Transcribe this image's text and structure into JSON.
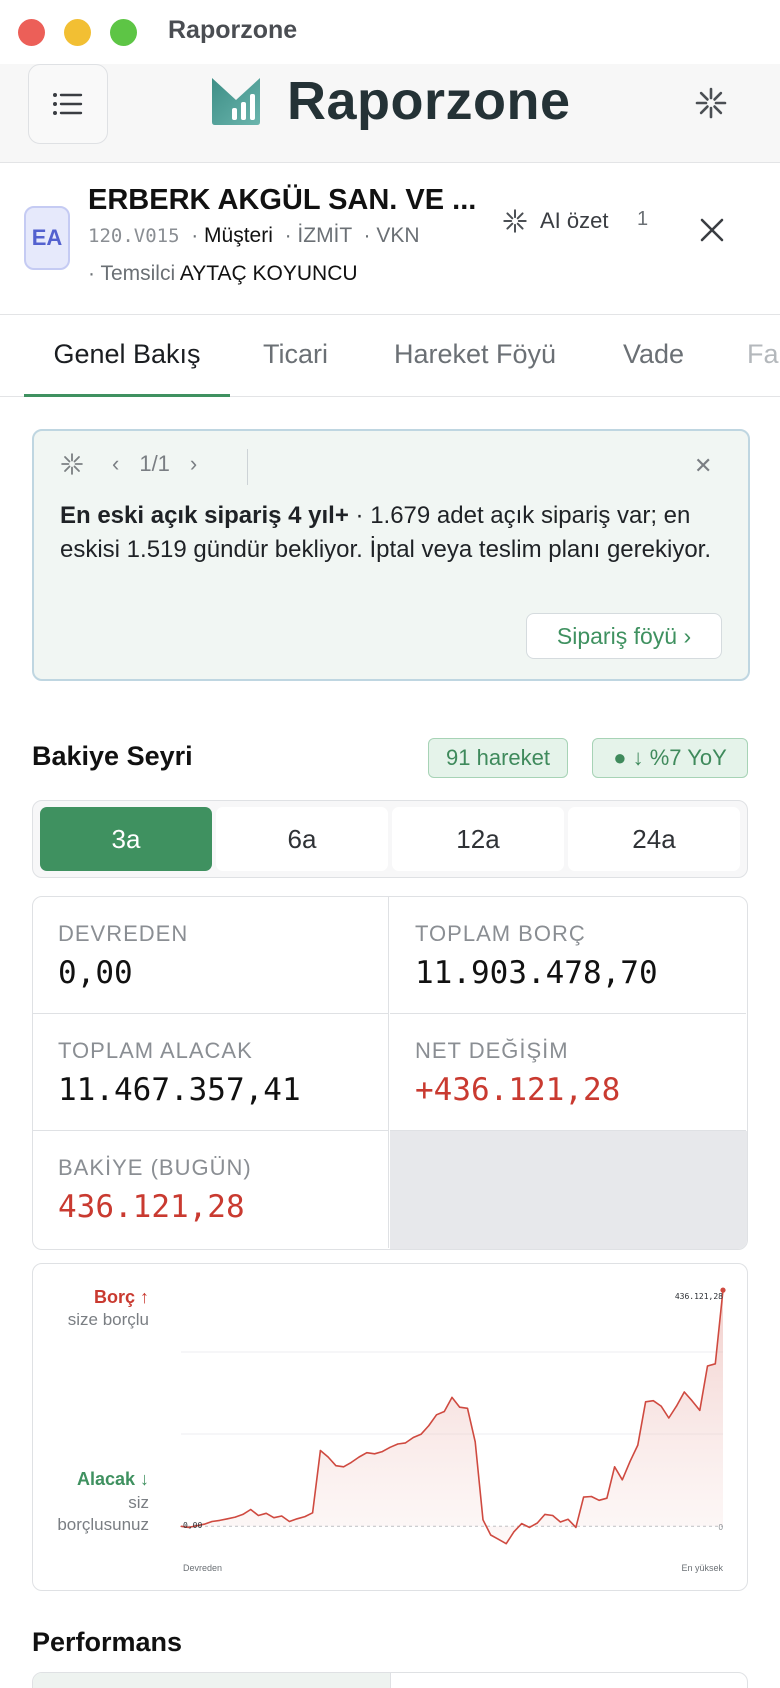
{
  "window": {
    "title": "Raporzone",
    "close_color": "#ec5f58",
    "min_color": "#f2bf33",
    "max_color": "#5dc545"
  },
  "app": {
    "brand": "Raporzone",
    "accent": "#3f9160",
    "danger": "#c93a30"
  },
  "customer": {
    "initials": "EA",
    "name": "ERBERK AKGÜL SAN. VE ...",
    "code": "120.V015",
    "type": "Müşteri",
    "city": "İZMİT",
    "tax_label": "VKN",
    "rep_label": "Temsilci",
    "rep_name": "AYTAÇ KOYUNCU",
    "ai_label": "AI özet",
    "ai_count": "1"
  },
  "tabs": [
    {
      "label": "Genel Bakış",
      "active": true
    },
    {
      "label": "Ticari"
    },
    {
      "label": "Hareket Föyü"
    },
    {
      "label": "Vade"
    },
    {
      "label": "Fa"
    }
  ],
  "insight": {
    "pager": "1/1",
    "title": "En eski açık sipariş 4 yıl+",
    "body": " · 1.679 adet açık sipariş var; en eskisi 1.519 gündür bekliyor. İptal veya teslim planı gerekiyor.",
    "action": "Sipariş föyü ›"
  },
  "balance": {
    "title": "Bakiye Seyri",
    "moves_badge": "91 hareket",
    "trend_badge": "● ↓ %7 YoY",
    "periods": [
      "3a",
      "6a",
      "12a",
      "24a"
    ],
    "active_period": "3a",
    "stats": [
      {
        "label": "DEVREDEN",
        "value": "0,00"
      },
      {
        "label": "TOPLAM BORÇ",
        "value": "11.903.478,70"
      },
      {
        "label": "TOPLAM ALACAK",
        "value": "11.467.357,41"
      },
      {
        "label": "NET DEĞİŞİM",
        "value": "+436.121,28"
      },
      {
        "label": "BAKİYE (BUGÜN)",
        "value": "436.121,28"
      }
    ]
  },
  "chart_data": {
    "type": "area",
    "debit_label": "Borç ↑",
    "debit_sub": "size borçlu",
    "credit_label": "Alacak ↓",
    "credit_sub": "siz borçlusunuz",
    "start_label": "0,00",
    "end_label": "436.121,28",
    "zero_label": "0",
    "x_start": "Devreden",
    "x_end": "En yüksek",
    "ylim": [
      -40000,
      440000
    ],
    "values": [
      0,
      -2000,
      1000,
      4000,
      9000,
      11000,
      14000,
      17000,
      22000,
      31000,
      20000,
      24000,
      16000,
      19000,
      9000,
      14000,
      18000,
      25000,
      140000,
      128000,
      112000,
      110000,
      118000,
      128000,
      136000,
      134000,
      138000,
      146000,
      152000,
      154000,
      164000,
      170000,
      186000,
      206000,
      212000,
      238000,
      220000,
      218000,
      156000,
      12000,
      -16000,
      -24000,
      -32000,
      -10000,
      5000,
      -2000,
      6000,
      22000,
      20000,
      8000,
      13000,
      -2000,
      54000,
      55000,
      48000,
      52000,
      110000,
      86000,
      120000,
      150000,
      230000,
      232000,
      222000,
      200000,
      222000,
      248000,
      232000,
      214000,
      296000,
      300000,
      436121
    ]
  },
  "performance": {
    "title": "Performans"
  }
}
